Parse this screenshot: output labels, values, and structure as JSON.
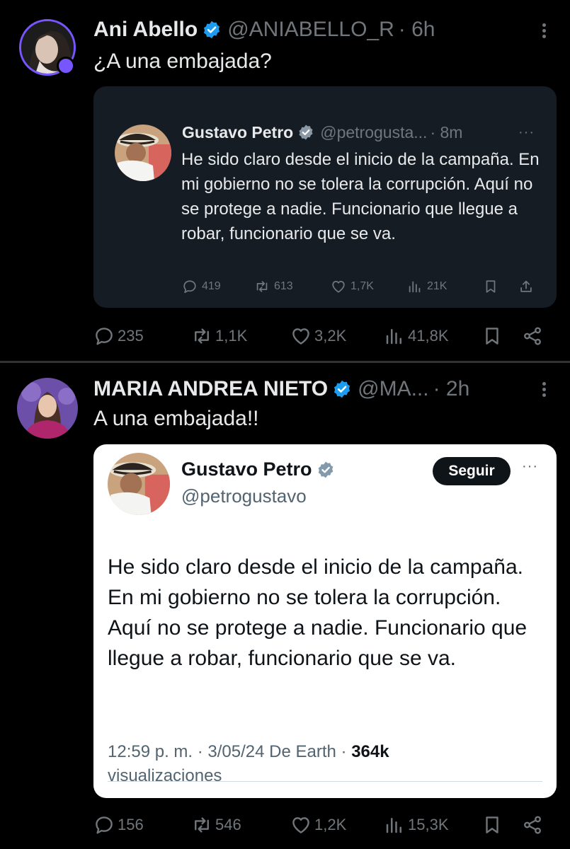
{
  "tweet1": {
    "author_name": "Ani Abello",
    "author_handle": "@ANIABELLO_R",
    "time": "· 6h",
    "text": "¿A una embajada?",
    "quoted": {
      "author_name": "Gustavo Petro",
      "author_handle": "@petrogusta...",
      "time": "· 8m",
      "more": "···",
      "text": "He sido claro desde el inicio de la campaña. En mi gobierno no se tolera la corrupción. Aquí no se protege a nadie. Funcionario que llegue a robar, funcionario que se va.",
      "replies": "419",
      "reposts": "613",
      "likes": "1,7K",
      "views": "21K"
    },
    "replies": "235",
    "reposts": "1,1K",
    "likes": "3,2K",
    "views": "41,8K"
  },
  "tweet2": {
    "author_name": "MARIA ANDREA NIETO",
    "author_handle": "@MA...",
    "time": "· 2h",
    "text": "A una embajada!!",
    "embedded": {
      "author_name": "Gustavo Petro",
      "author_handle": "@petrogustavo",
      "follow_label": "Seguir",
      "more": "···",
      "text": "He sido claro desde el inicio de la campaña. En mi gobierno no se tolera la corrupción. Aquí no se protege a nadie. Funcionario que llegue a robar, funcionario que se va.",
      "meta": "12:59 p. m. · 3/05/24 De Earth ·",
      "views_count": "364k",
      "views_label": "visualizaciones"
    },
    "replies": "156",
    "reposts": "546",
    "likes": "1,2K",
    "views": "15,3K"
  },
  "colors": {
    "background": "#000000",
    "verified_blue": "#1d9bf0",
    "muted": "#71767b",
    "quote_card": "#151c24",
    "avatar_ring": "#7856ff"
  },
  "icons": [
    "reply-icon",
    "repost-icon",
    "like-icon",
    "views-icon",
    "bookmark-icon",
    "share-icon",
    "verified-icon",
    "more-icon"
  ]
}
